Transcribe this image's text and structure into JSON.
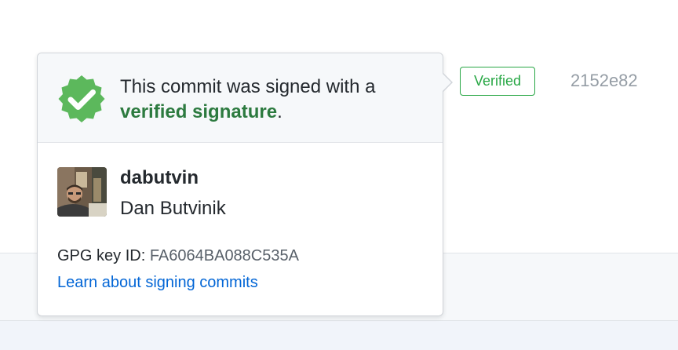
{
  "badge": {
    "label": "Verified"
  },
  "commit": {
    "sha": "2152e82"
  },
  "popover": {
    "header_text": "This commit was signed with a",
    "header_link": "verified signature",
    "header_suffix": ".",
    "user": {
      "username": "dabutvin",
      "full_name": "Dan Butvinik",
      "avatar_icon": "user-avatar"
    },
    "gpg": {
      "label": "GPG key ID:",
      "value": "FA6064BA088C535A"
    },
    "learn_link": "Learn about signing commits"
  },
  "colors": {
    "verified_green": "#28a745",
    "verified_text_green": "#2c7a3f",
    "link_blue": "#0366d6",
    "seal_green": "#5cb85c"
  }
}
